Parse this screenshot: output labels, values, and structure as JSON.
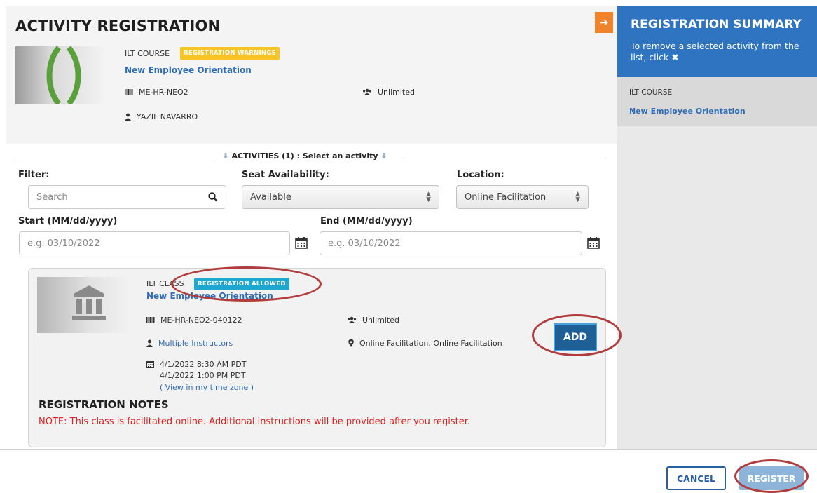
{
  "page": {
    "title": "ACTIVITY REGISTRATION"
  },
  "course": {
    "type": "ILT COURSE",
    "badge": "REGISTRATION WARNINGS",
    "name": "New Employee Orientation",
    "code": "ME-HR-NEO2",
    "seats": "Unlimited",
    "owner": "YAZIL NAVARRO"
  },
  "summary": {
    "title": "REGISTRATION SUMMARY",
    "description": "To remove a selected activity from the list, click",
    "item_type": "ILT COURSE",
    "item_name": "New Employee Orientation"
  },
  "activities": {
    "header": "ACTIVITIES (1) : Select an activity"
  },
  "filters": {
    "filter_label": "Filter:",
    "search_placeholder": "Search",
    "seat_label": "Seat Availability:",
    "seat_value": "Available",
    "location_label": "Location:",
    "location_value": "Online Facilitation",
    "start_label": "Start (MM/dd/yyyy)",
    "start_placeholder": "e.g. 03/10/2022",
    "end_label": "End (MM/dd/yyyy)",
    "end_placeholder": "e.g. 03/10/2022"
  },
  "activity": {
    "type": "ILT CLASS",
    "badge": "REGISTRATION ALLOWED",
    "name": "New Employee Orientation",
    "code": "ME-HR-NEO2-040122",
    "seats": "Unlimited",
    "instructors": "Multiple Instructors",
    "location": "Online Facilitation, Online Facilitation",
    "start": "4/1/2022 8:30 AM PDT",
    "end": "4/1/2022 1:00 PM PDT",
    "timezone_link": "( View in my time zone )",
    "add_label": "ADD",
    "notes_title": "REGISTRATION NOTES",
    "notes_text": "NOTE: This class is facilitated online. Additional instructions will be provided after you register."
  },
  "footer": {
    "cancel_label": "CANCEL",
    "register_label": "REGISTER"
  },
  "colors": {
    "primary_blue": "#2f74c0",
    "link_blue": "#2e6cb5",
    "warning_badge": "#f7c325",
    "allowed_badge": "#1fa7cf",
    "add_button": "#1e5f96",
    "collapse_orange": "#f0822c",
    "note_red": "#e21d1d",
    "annotation_ring": "#b23b3b"
  }
}
